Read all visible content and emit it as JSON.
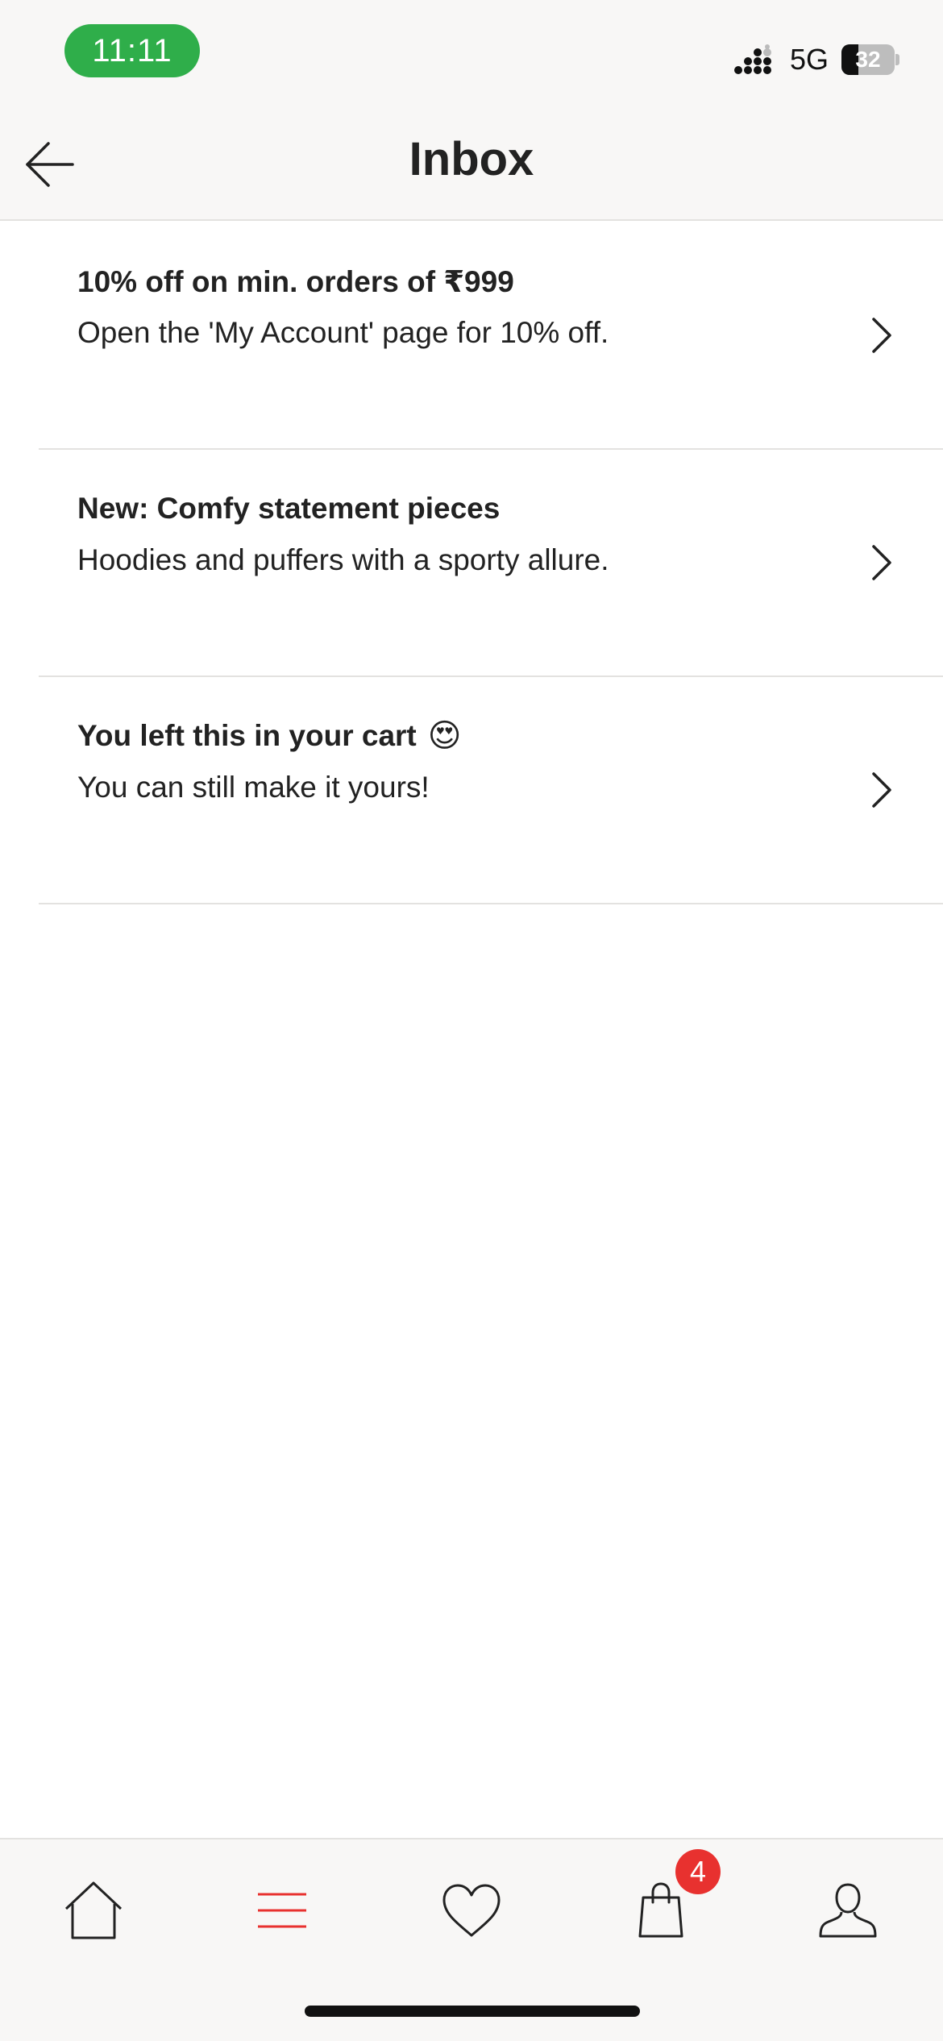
{
  "status_bar": {
    "time": "11:11",
    "network": "5G",
    "battery_level": "32",
    "battery_fraction": 0.32,
    "time_pill_color": "#2fae4a"
  },
  "header": {
    "title": "Inbox",
    "back_icon": "arrow-left-icon"
  },
  "inbox": {
    "items": [
      {
        "title": "10% off on min. orders of ₹999",
        "body": "Open the 'My Account' page for 10% off.",
        "emoji": ""
      },
      {
        "title": "New: Comfy statement pieces",
        "body": "Hoodies and puffers with a sporty allure.",
        "emoji": ""
      },
      {
        "title": "You left this in your cart",
        "body": "You can still make it yours!",
        "emoji": "😍"
      }
    ]
  },
  "bottom_nav": {
    "items": [
      {
        "icon": "home-icon"
      },
      {
        "icon": "menu-icon",
        "active": true
      },
      {
        "icon": "heart-icon"
      },
      {
        "icon": "shopping-bag-icon"
      },
      {
        "icon": "profile-icon"
      }
    ],
    "cart_badge": "4",
    "accent_color": "#e8312f"
  }
}
